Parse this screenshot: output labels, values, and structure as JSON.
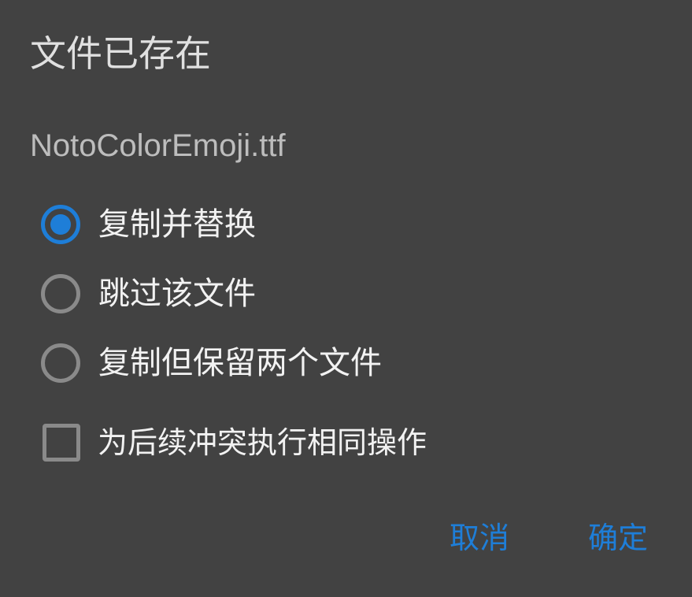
{
  "dialog": {
    "title": "文件已存在",
    "filename": "NotoColorEmoji.ttf",
    "options": [
      {
        "label": "复制并替换",
        "selected": true
      },
      {
        "label": "跳过该文件",
        "selected": false
      },
      {
        "label": "复制但保留两个文件",
        "selected": false
      }
    ],
    "apply_to_all": {
      "label": "为后续冲突执行相同操作",
      "checked": false
    },
    "buttons": {
      "cancel": "取消",
      "ok": "确定"
    },
    "colors": {
      "background": "#424242",
      "accent": "#1e7ed8",
      "control_border": "#8a8a8a"
    }
  }
}
